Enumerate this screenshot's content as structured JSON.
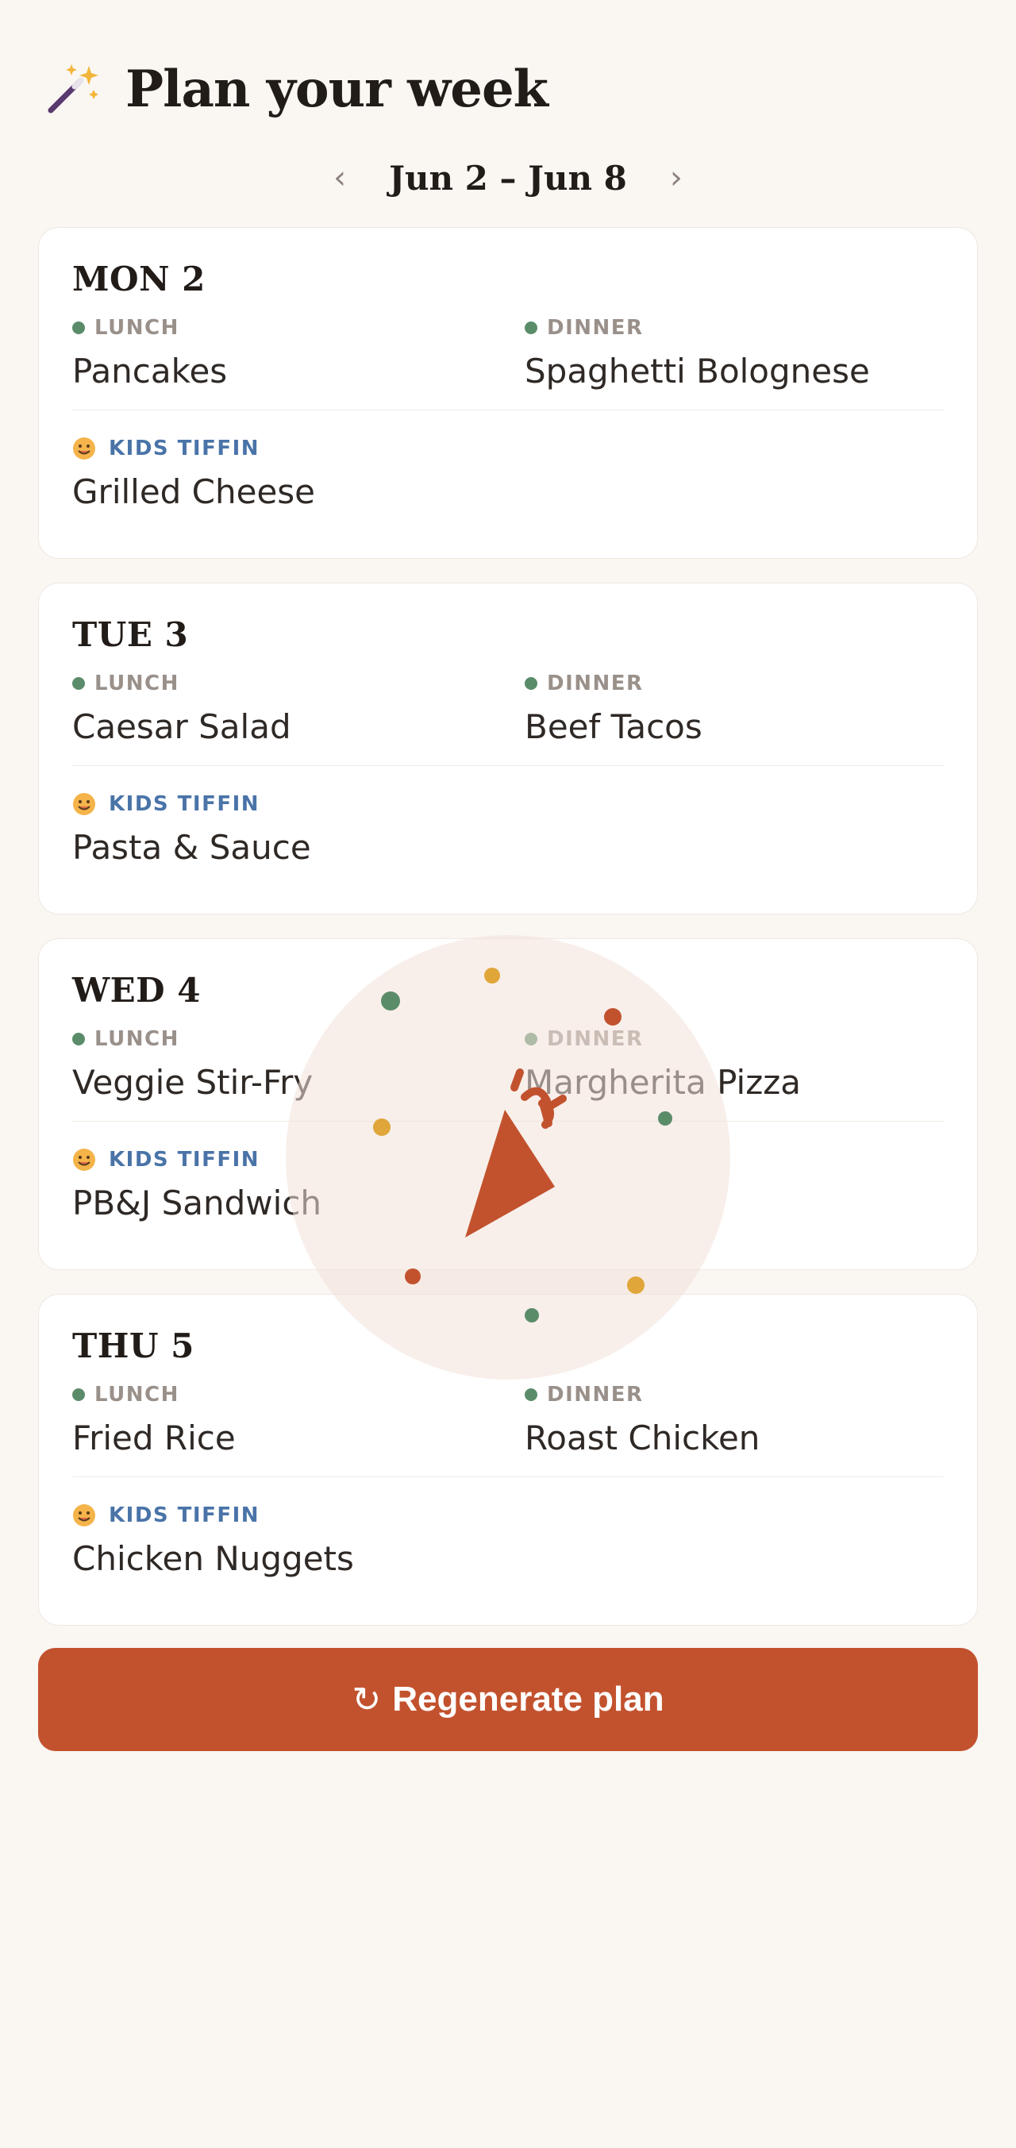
{
  "header": {
    "title": "Plan your week",
    "icon": "magic-wand-icon"
  },
  "week_nav": {
    "prev_label": "‹",
    "range": "Jun 2 – Jun 8",
    "next_label": "›"
  },
  "labels": {
    "lunch": "LUNCH",
    "dinner": "DINNER",
    "kids_tiffin": "KIDS TIFFIN"
  },
  "days": [
    {
      "title": "MON 2",
      "lunch": "Pancakes",
      "dinner": "Spaghetti Bolognese",
      "tiffin": "Grilled Cheese"
    },
    {
      "title": "TUE 3",
      "lunch": "Caesar Salad",
      "dinner": "Beef Tacos",
      "tiffin": "Pasta & Sauce"
    },
    {
      "title": "WED 4",
      "lunch": "Veggie Stir-Fry",
      "dinner": "Margherita Pizza",
      "tiffin": "PB&J Sandwich"
    },
    {
      "title": "THU 5",
      "lunch": "Fried Rice",
      "dinner": "Roast Chicken",
      "tiffin": "Chicken Nuggets"
    }
  ],
  "regenerate": {
    "glyph": "↻",
    "label": "Regenerate plan"
  },
  "loading_overlay": {
    "icon": "pizza-slice-icon"
  },
  "colors": {
    "accent": "#c2522e",
    "background": "#faf6f2",
    "meal_dot": "#5b8c6a",
    "tiffin_label": "#4a74a8",
    "meal_label": "#9a908a",
    "confetti_yellow": "#e0a63a"
  }
}
